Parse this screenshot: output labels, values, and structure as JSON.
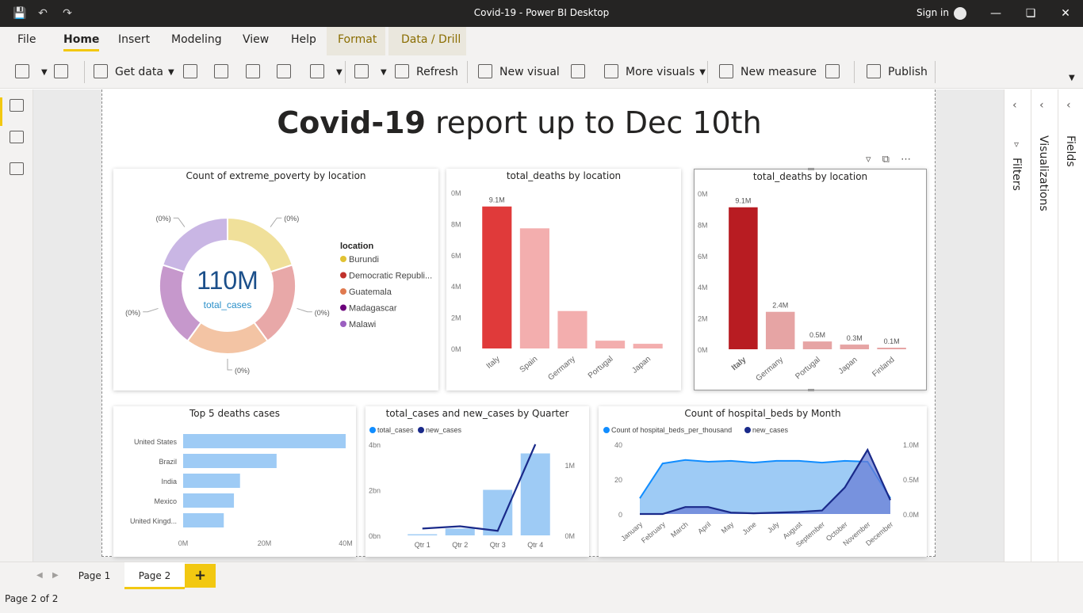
{
  "window": {
    "title": "Covid-19 - Power BI Desktop",
    "signin": "Sign in"
  },
  "menu": {
    "file": "File",
    "tabs": [
      "Home",
      "Insert",
      "Modeling",
      "View",
      "Help"
    ],
    "context_tabs": [
      "Format",
      "Data / Drill"
    ]
  },
  "ribbon": {
    "get_data": "Get data",
    "refresh": "Refresh",
    "new_visual": "New visual",
    "more_visuals": "More visuals",
    "new_measure": "New measure",
    "publish": "Publish"
  },
  "report": {
    "title_bold": "Covid-19",
    "title_rest": " report up to Dec 10th"
  },
  "panes": {
    "filters": "Filters",
    "visualizations": "Visualizations",
    "fields": "Fields"
  },
  "pages": {
    "tabs": [
      "Page 1",
      "Page 2"
    ],
    "add": "+",
    "status": "Page 2 of 2"
  },
  "colors": {
    "accent": "#f2c811",
    "titlebar": "#252423",
    "light_blue": "#9ecbf5",
    "navy": "#1a2a8a"
  },
  "chart_data": [
    {
      "type": "pie",
      "title": "Count of extreme_poverty by location",
      "center_value": "110M",
      "center_label": "total_cases",
      "legend_title": "location",
      "categories": [
        "Burundi",
        "Democratic Republi...",
        "Guatemala",
        "Madagascar",
        "Malawi"
      ],
      "values": [
        1,
        1,
        1,
        1,
        1
      ],
      "segment_colors": [
        "#f0e09a",
        "#e8a8a8",
        "#f3c4a4",
        "#c698cc",
        "#c9b6e4"
      ],
      "legend_colors": [
        "#e1c233",
        "#c0312b",
        "#e07a4f",
        "#6b007b",
        "#9b5fc0"
      ],
      "slice_labels": [
        "(0%)",
        "(0%)",
        "(0%)",
        "(0%)",
        "(0%)"
      ]
    },
    {
      "type": "bar",
      "title": "total_deaths by location",
      "categories": [
        "Italy",
        "Spain",
        "Germany",
        "Portugal",
        "Japan"
      ],
      "values": [
        9.1,
        7.7,
        2.4,
        0.5,
        0.3
      ],
      "data_labels": [
        "9.1M",
        "",
        "",
        "",
        ""
      ],
      "yticks": [
        "0M",
        "2M",
        "4M",
        "6M",
        "8M",
        "0M"
      ],
      "ylim": [
        0,
        10
      ],
      "colors": [
        "#e03a3a",
        "#f3aeae",
        "#f3aeae",
        "#f3aeae",
        "#f3aeae"
      ]
    },
    {
      "type": "bar",
      "title": "total_deaths by location",
      "categories": [
        "Italy",
        "Germany",
        "Portugal",
        "Japan",
        "Finland"
      ],
      "values": [
        9.1,
        2.4,
        0.5,
        0.3,
        0.1
      ],
      "data_labels": [
        "9.1M",
        "2.4M",
        "0.5M",
        "0.3M",
        "0.1M"
      ],
      "yticks": [
        "0M",
        "2M",
        "4M",
        "6M",
        "8M",
        "0M"
      ],
      "ylim": [
        0,
        10
      ],
      "colors": [
        "#b81c22",
        "#e6a4a4",
        "#e6a4a4",
        "#e6a4a4",
        "#e6a4a4"
      ]
    },
    {
      "type": "bar",
      "orientation": "horizontal",
      "title": "Top 5 deaths cases",
      "categories": [
        "United States",
        "Brazil",
        "India",
        "Mexico",
        "United Kingd..."
      ],
      "values": [
        40,
        23,
        14,
        12.5,
        10
      ],
      "xticks": [
        "0M",
        "20M",
        "40M"
      ],
      "xlim": [
        0,
        40
      ]
    },
    {
      "type": "bar",
      "title": "total_cases and new_cases by Quarter",
      "categories": [
        "Qtr 1",
        "Qtr 2",
        "Qtr 3",
        "Qtr 4"
      ],
      "series": [
        {
          "name": "total_cases",
          "values": [
            0.05,
            0.3,
            2.0,
            3.6
          ]
        },
        {
          "name": "new_cases",
          "values": [
            0.3,
            0.4,
            0.2,
            4.0
          ]
        }
      ],
      "yticks_left": [
        "0bn",
        "2bn",
        "4bn"
      ],
      "yticks_right": [
        "0M",
        "1M"
      ],
      "ylim": [
        0,
        4
      ]
    },
    {
      "type": "area",
      "title": "Count of hospital_beds by Month",
      "categories": [
        "January",
        "February",
        "March",
        "April",
        "May",
        "June",
        "July",
        "August",
        "September",
        "October",
        "November",
        "December"
      ],
      "series": [
        {
          "name": "Count of hospital_beds_per_thousand",
          "values": [
            9,
            29,
            31,
            30,
            30.5,
            29.5,
            30.5,
            30.5,
            29.5,
            30.5,
            30,
            9
          ]
        },
        {
          "name": "new_cases",
          "values": [
            0,
            0,
            0.1,
            0.1,
            0.02,
            0.01,
            0.02,
            0.03,
            0.05,
            0.38,
            0.92,
            0.2
          ]
        }
      ],
      "yticks_left": [
        "0",
        "20",
        "40"
      ],
      "yticks_right": [
        "0.0M",
        "0.5M",
        "1.0M"
      ],
      "ylim": [
        0,
        40
      ],
      "ylim_right": [
        0,
        1.0
      ]
    }
  ]
}
